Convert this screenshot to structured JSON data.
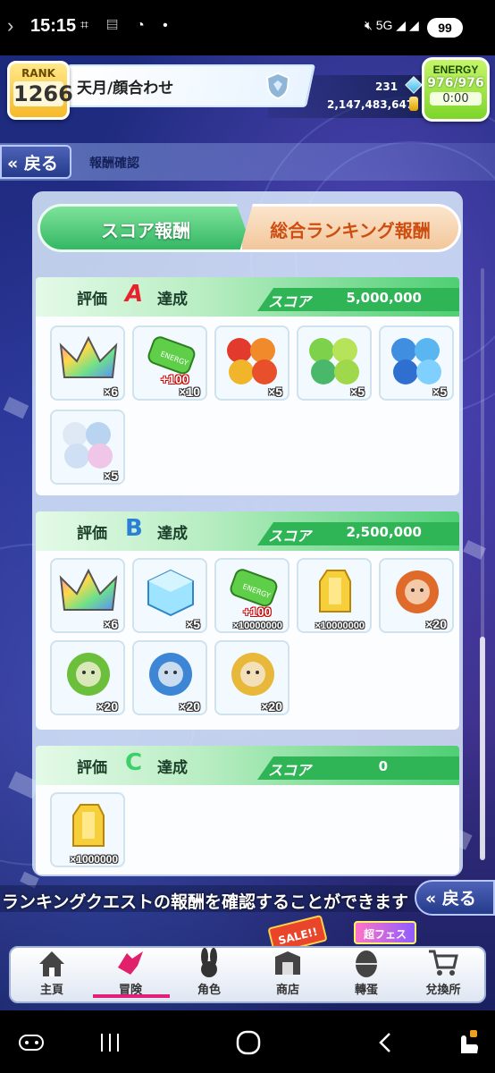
{
  "status_bar": {
    "time": "15:15",
    "network": "5G",
    "battery": "99"
  },
  "header": {
    "rank_label": "RANK",
    "rank_value": "1266",
    "player_name": "天月/顔合わせ",
    "crystals": "231",
    "gold": "2,147,483,647",
    "energy_label": "ENERGY",
    "energy_value": "976/976",
    "energy_timer": "0:00"
  },
  "nav": {
    "back_label": "戻る",
    "page_title": "報酬確認"
  },
  "tabs": [
    {
      "label": "スコア報酬",
      "active": true
    },
    {
      "label": "総合ランキング報酬",
      "active": false
    }
  ],
  "sections": [
    {
      "rating_label": "評価",
      "grade": "A",
      "grade_color": "#e8212d",
      "achieved_label": "達成",
      "score_label": "スコア",
      "score_value": "5,000,000",
      "items": [
        {
          "icon": "rainbow-crown-icon",
          "qty": "×6"
        },
        {
          "icon": "energy-battery-icon",
          "qty": "×10",
          "plus": "+100"
        },
        {
          "icon": "red-fruit-monster-icon",
          "qty": "×5"
        },
        {
          "icon": "green-fruit-monster-icon",
          "qty": "×5"
        },
        {
          "icon": "blue-fruit-monster-icon",
          "qty": "×5"
        },
        {
          "icon": "white-fruit-monster-icon",
          "qty": "×5"
        }
      ]
    },
    {
      "rating_label": "評価",
      "grade": "B",
      "grade_color": "#2a7fd6",
      "achieved_label": "達成",
      "score_label": "スコア",
      "score_value": "2,500,000",
      "items": [
        {
          "icon": "rainbow-crown-icon",
          "qty": "×6"
        },
        {
          "icon": "blue-crystal-cube-icon",
          "qty": "×5"
        },
        {
          "icon": "energy-battery-icon",
          "qty": "×10000000",
          "plus": "+100"
        },
        {
          "icon": "gold-bar-icon",
          "qty": "×10000000"
        },
        {
          "icon": "red-character-icon",
          "qty": "×20"
        },
        {
          "icon": "green-character-icon",
          "qty": "×20"
        },
        {
          "icon": "blue-character-icon",
          "qty": "×20"
        },
        {
          "icon": "gold-character-icon",
          "qty": "×20"
        }
      ]
    },
    {
      "rating_label": "評価",
      "grade": "C",
      "grade_color": "#3ccf6a",
      "achieved_label": "達成",
      "score_label": "スコア",
      "score_value": "0",
      "items": [
        {
          "icon": "gold-bar-icon",
          "qty": "×1000000"
        }
      ]
    }
  ],
  "ticker": "ランキングクエストの報酬を確認することができます",
  "bottom_nav": [
    {
      "label": "主頁",
      "icon": "home-icon"
    },
    {
      "label": "冒険",
      "icon": "adventure-icon",
      "active": true
    },
    {
      "label": "角色",
      "icon": "rabbit-icon"
    },
    {
      "label": "商店",
      "icon": "shop-icon",
      "badge": "SALE!!"
    },
    {
      "label": "轉蛋",
      "icon": "egg-icon",
      "badge": "超フェス"
    },
    {
      "label": "兌換所",
      "icon": "cart-icon"
    }
  ]
}
